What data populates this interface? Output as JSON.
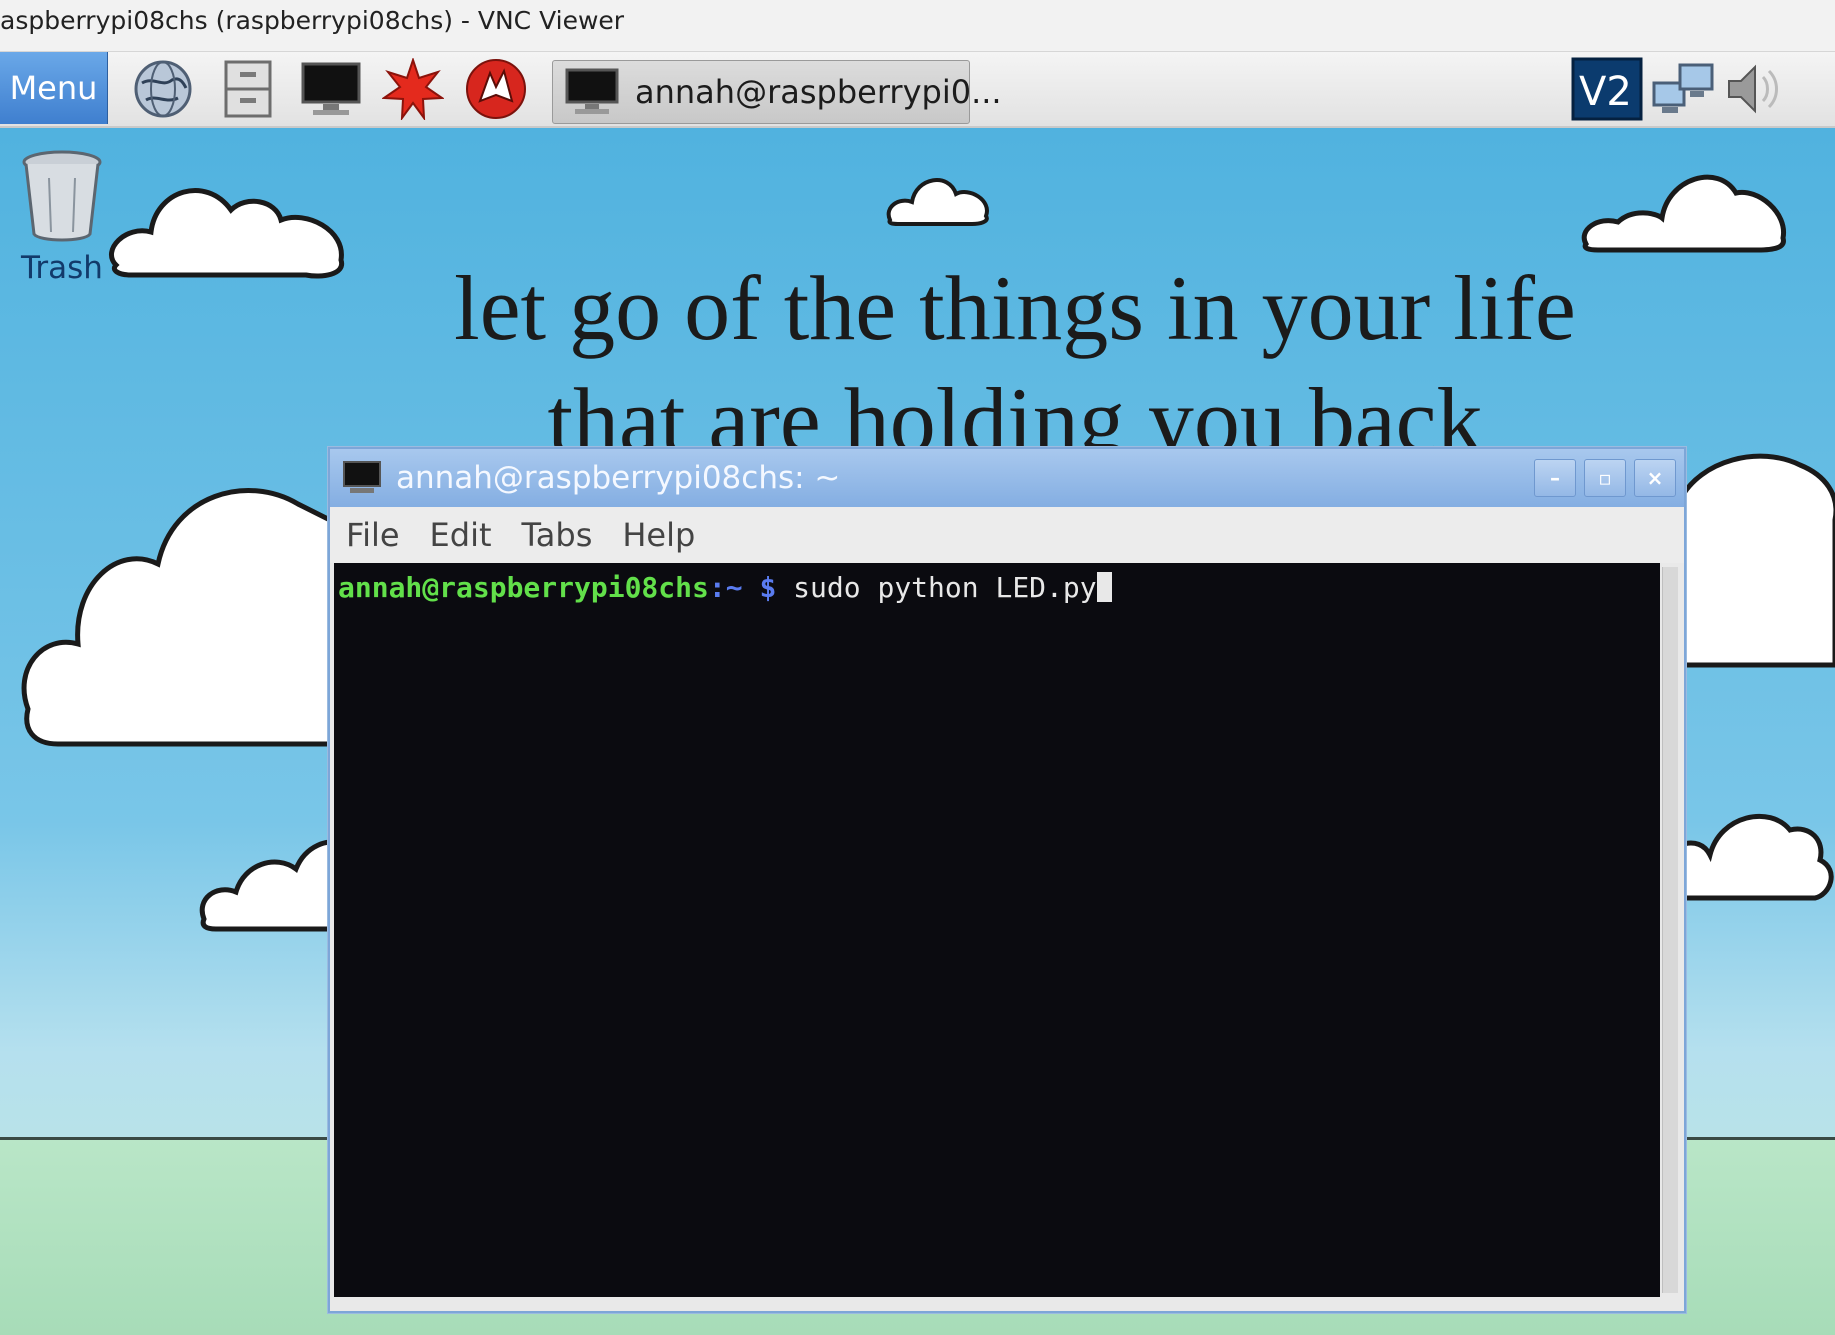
{
  "vnc_window": {
    "title": "aspberrypi08chs (raspberrypi08chs) - VNC Viewer"
  },
  "taskbar": {
    "menu_label": "Menu",
    "launchers": [
      "globe-icon",
      "file-manager-icon",
      "terminal-icon",
      "wolfram-icon",
      "mathematica-icon"
    ],
    "task_button_label": "annah@raspberrypi0...",
    "tray": [
      "vnc-icon",
      "network-icon",
      "volume-icon"
    ]
  },
  "desktop": {
    "trash_label": "Trash",
    "quote_line1": "let go of the things in your life",
    "quote_line2": "that are holding you back"
  },
  "terminal": {
    "title": "annah@raspberrypi08chs: ~",
    "menu": [
      "File",
      "Edit",
      "Tabs",
      "Help"
    ],
    "prompt_user": "annah@raspberrypi08chs",
    "prompt_path": ":~",
    "prompt_symbol": " $",
    "command": " sudo python LED.py"
  },
  "colors": {
    "sky": "#5db7e0",
    "taskbar": "#e8e8e8",
    "menu_button": "#4f8fdc",
    "titlebar": "#94b8e6",
    "terminal_bg": "#0b0b10",
    "prompt_green": "#62e04a",
    "prompt_blue": "#5a7cf0"
  }
}
